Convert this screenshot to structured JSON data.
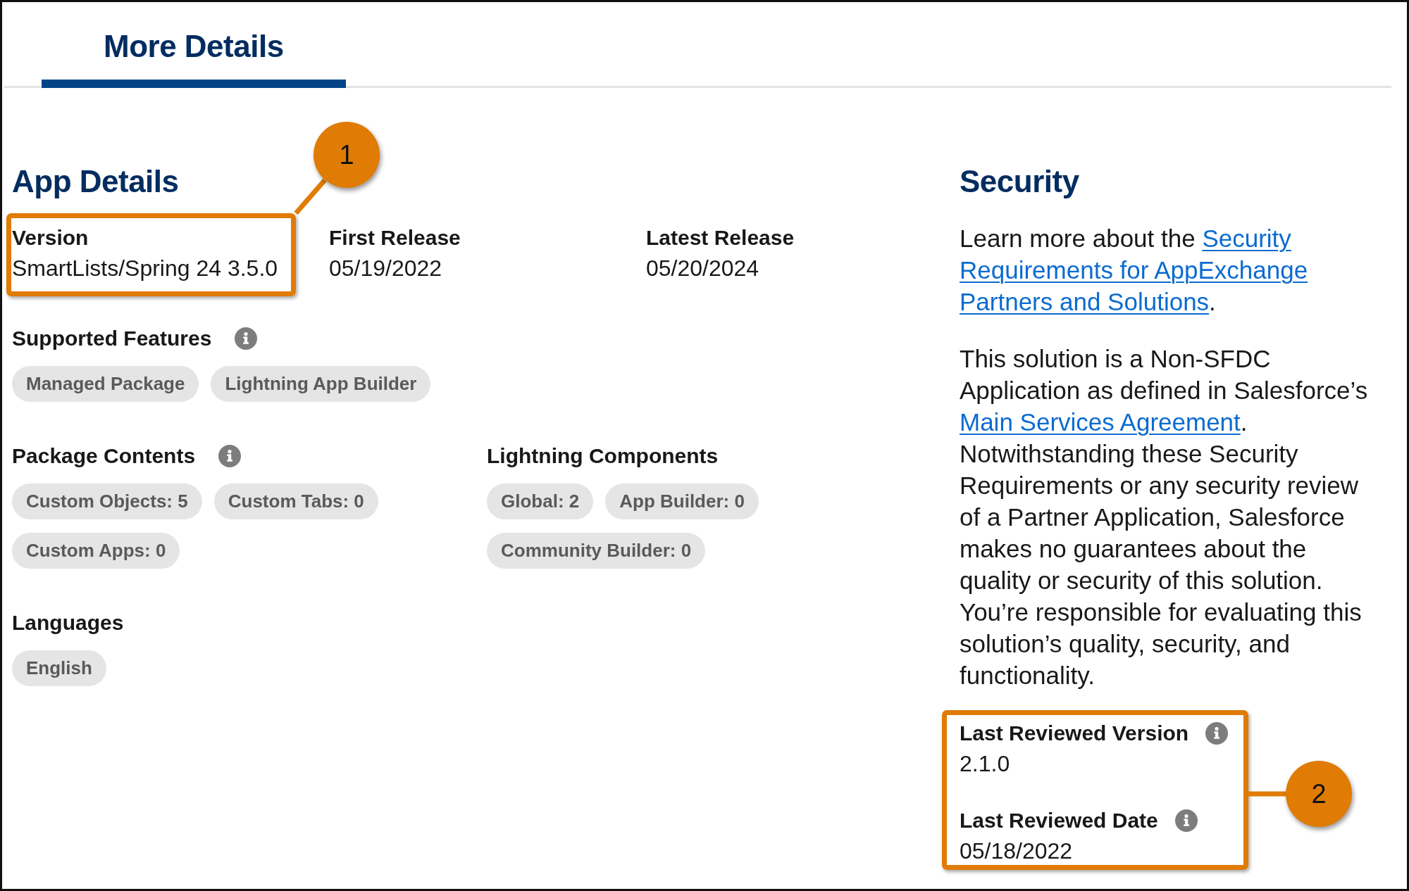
{
  "tabs": [
    {
      "label": "More Details",
      "selected": true
    }
  ],
  "app_details": {
    "title": "App Details",
    "release_fields": [
      {
        "label": "Version",
        "value": "SmartLists/Spring 24 3.5.0",
        "callout": "1"
      },
      {
        "label": "First Release",
        "value": "05/19/2022"
      },
      {
        "label": "Latest Release",
        "value": "05/20/2024"
      }
    ],
    "section_rows": [
      [
        {
          "title": "Supported Features",
          "info": true,
          "tags": [
            "Managed Package",
            "Lightning App Builder"
          ]
        }
      ],
      [
        {
          "title": "Package Contents",
          "info": true,
          "tags": [
            "Custom Objects: 5",
            "Custom Tabs: 0",
            "Custom Apps: 0"
          ]
        },
        {
          "title": "Lightning Components",
          "info": false,
          "tags": [
            "Global: 2",
            "App Builder: 0",
            "Community Builder: 0"
          ]
        }
      ],
      [
        {
          "title": "Languages",
          "info": false,
          "tags": [
            "English"
          ]
        }
      ]
    ]
  },
  "security": {
    "title": "Security",
    "paragraphs": [
      {
        "parts": [
          {
            "kind": "text",
            "text": "Learn more about the "
          },
          {
            "kind": "link",
            "lines": [
              "Security",
              "Requirements for AppExchange",
              "Partners and Solutions"
            ]
          },
          {
            "kind": "text",
            "text": "."
          }
        ]
      },
      {
        "parts": [
          {
            "kind": "text",
            "text": "This solution is a Non-SFDC Application as defined in Salesforce’s "
          },
          {
            "kind": "link",
            "lines": [
              "Main Services Agreement"
            ]
          },
          {
            "kind": "text",
            "text": ". Notwithstanding these Security Requirements or any security review of a Partner Application, Salesforce makes no guarantees about the quality or security of this solution. You’re responsible for evaluating this solution’s quality, security, and functionality."
          }
        ]
      }
    ],
    "review": {
      "callout": "2",
      "fields": [
        {
          "label": "Last Reviewed Version",
          "value": "2.1.0",
          "info": true
        },
        {
          "label": "Last Reviewed Date",
          "value": "05/18/2022",
          "info": true
        }
      ]
    }
  }
}
